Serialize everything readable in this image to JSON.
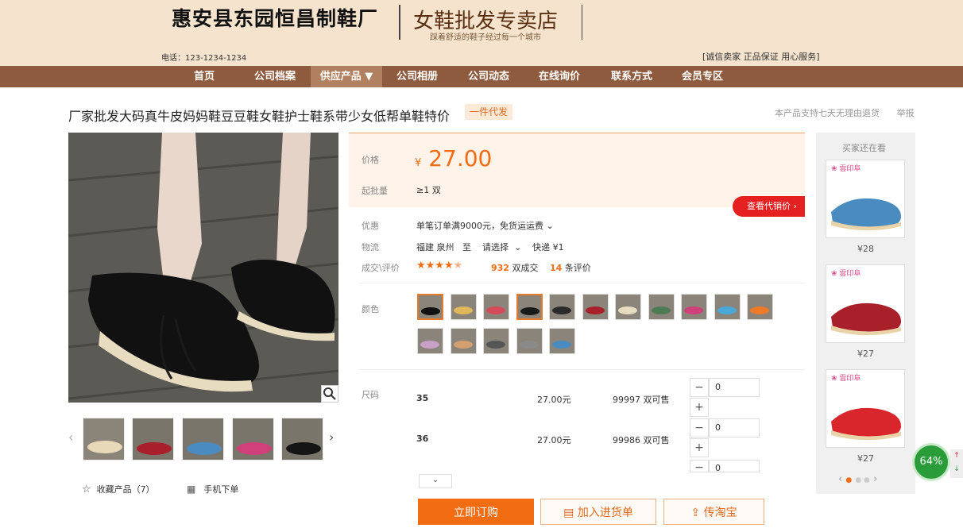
{
  "header": {
    "company": "惠安县东园恒昌制鞋厂",
    "store": "女鞋批发专卖店",
    "slogan": "踩着舒适的鞋子经过每一个城市",
    "phone": "电话：123-1234-1234",
    "promise": "[诚信卖家  正品保证  用心服务]"
  },
  "nav": [
    "首页",
    "公司档案",
    "供应产品 ▼",
    "公司相册",
    "公司动态",
    "在线询价",
    "联系方式",
    "会员专区"
  ],
  "product": {
    "title": "厂家批发大码真牛皮妈妈鞋豆豆鞋女鞋护士鞋系带少女低帮单鞋特价",
    "badge": "一件代发",
    "support": "本产品支持七天无理由退货",
    "report": "举报"
  },
  "price": {
    "label": "价格",
    "currency": "¥",
    "value": "27.00",
    "moq_label": "起批量",
    "moq": "≥1 双",
    "see_btn": "查看代销价 ›"
  },
  "info": {
    "discount_label": "优惠",
    "discount": "单笔订单满9000元，免货运运费 ⌄",
    "ship_label": "物流",
    "ship": "福建 泉州   至    请选择  ⌄    快递 ¥1",
    "deal_label": "成交\\评价",
    "rating": "4.5",
    "deals_num": "932",
    "deals_unit": "双成交",
    "reviews_num": "14",
    "reviews_unit": "条评价"
  },
  "colors": {
    "label": "颜色",
    "count": 16,
    "selected": [
      0,
      3
    ]
  },
  "sizes": {
    "label": "尺码",
    "rows": [
      {
        "size": "35",
        "price": "27.00元",
        "stock": "99997 双可售",
        "qty": "0"
      },
      {
        "size": "36",
        "price": "27.00元",
        "stock": "99986 双可售",
        "qty": "0"
      },
      {
        "qty": "0"
      }
    ]
  },
  "actions": {
    "buy": "立即订购",
    "cart": "加入进货单",
    "taobao": "传淘宝"
  },
  "gallery": {
    "fav": "收藏产品（7）",
    "mobile": "手机下单"
  },
  "sidebar": {
    "title": "买家还在看",
    "brand": "雲印阜",
    "items": [
      {
        "price": "¥28",
        "color": "#4a8cc0"
      },
      {
        "price": "¥27",
        "color": "#a8202a"
      },
      {
        "price": "¥27",
        "color": "#d9252c"
      }
    ]
  },
  "gauge": {
    "value": "64%"
  }
}
